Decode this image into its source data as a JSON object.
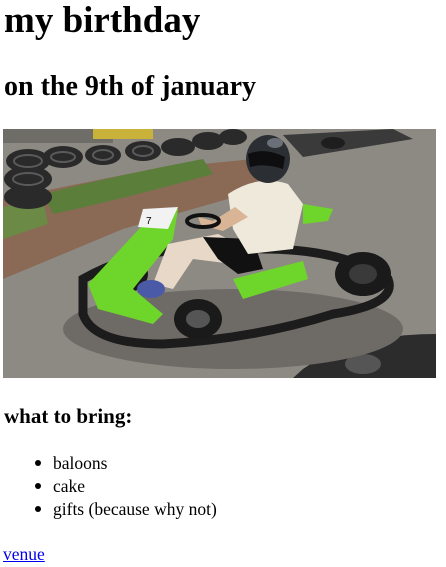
{
  "page": {
    "title": "my birthday",
    "subtitle": "on the 9th of january"
  },
  "photo": {
    "alt": "go-kart"
  },
  "bring": {
    "heading": "what to bring:",
    "items": [
      "baloons",
      "cake",
      "gifts (because why not)"
    ]
  },
  "links": {
    "venue": "venue"
  },
  "colors": {
    "link": "#0000ee",
    "kart_green": "#6ed62a",
    "text": "#000000"
  }
}
